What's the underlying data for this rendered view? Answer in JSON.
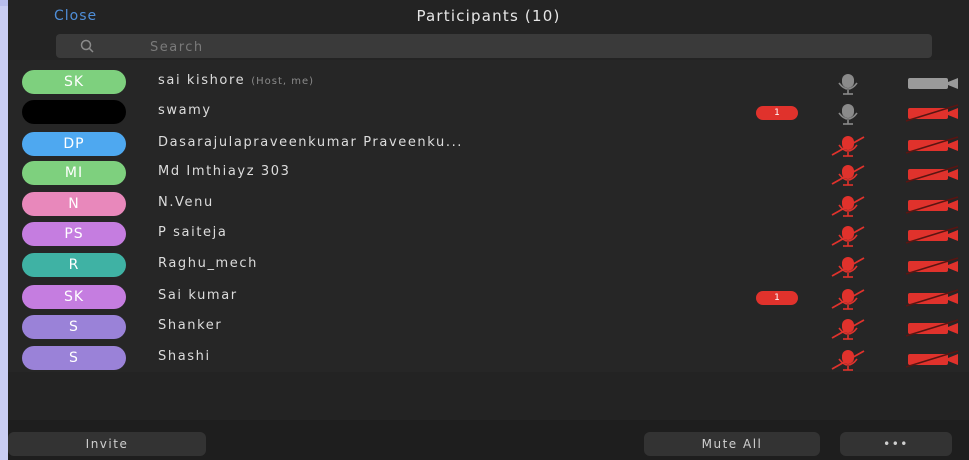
{
  "header": {
    "close_label": "Close",
    "title": "Participants (10)"
  },
  "search": {
    "placeholder": "Search"
  },
  "participants": [
    {
      "initials": "SK",
      "name": "sai kishore",
      "role": "(Host, me)",
      "avatar_color": "#7ed07e",
      "unread": "",
      "mic": "muted-grey",
      "video": "off-grey"
    },
    {
      "initials": "",
      "name": "swamy",
      "role": "",
      "avatar_color": "#000000",
      "unread": "1",
      "mic": "muted-grey",
      "video": "off-red"
    },
    {
      "initials": "DP",
      "name": "Dasarajulapraveenkumar Praveenku...",
      "role": "",
      "avatar_color": "#4ea8f0",
      "unread": "",
      "mic": "muted-red",
      "video": "off-red"
    },
    {
      "initials": "MI",
      "name": "Md Imthiayz 303",
      "role": "",
      "avatar_color": "#7ed07e",
      "unread": "",
      "mic": "muted-red",
      "video": "off-red"
    },
    {
      "initials": "N",
      "name": "N.Venu",
      "role": "",
      "avatar_color": "#e888bb",
      "unread": "",
      "mic": "muted-red",
      "video": "off-red"
    },
    {
      "initials": "PS",
      "name": "P saiteja",
      "role": "",
      "avatar_color": "#c57de0",
      "unread": "",
      "mic": "muted-red",
      "video": "off-red"
    },
    {
      "initials": "R",
      "name": "Raghu_mech",
      "role": "",
      "avatar_color": "#3fb2a4",
      "unread": "",
      "mic": "muted-red",
      "video": "off-red"
    },
    {
      "initials": "SK",
      "name": "Sai kumar",
      "role": "",
      "avatar_color": "#c57de0",
      "unread": "1",
      "mic": "muted-red",
      "video": "off-red"
    },
    {
      "initials": "S",
      "name": "Shanker",
      "role": "",
      "avatar_color": "#9a82d8",
      "unread": "",
      "mic": "muted-red",
      "video": "off-red"
    },
    {
      "initials": "S",
      "name": "Shashi",
      "role": "",
      "avatar_color": "#9a82d8",
      "unread": "",
      "mic": "muted-red",
      "video": "off-red"
    }
  ],
  "footer": {
    "invite_label": "Invite",
    "mute_all_label": "Mute All",
    "more_label": "•••"
  },
  "colors": {
    "accent": "#4f8ed8",
    "danger": "#e0322c",
    "background": "#232323"
  }
}
